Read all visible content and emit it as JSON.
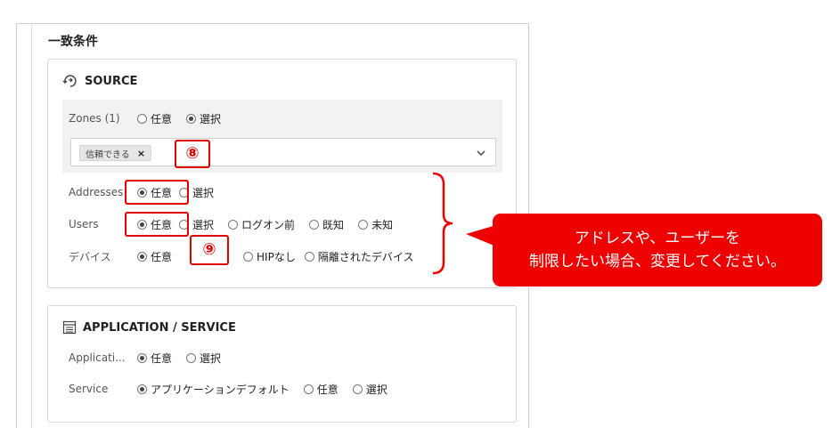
{
  "section": {
    "title": "一致条件"
  },
  "source": {
    "title": "SOURCE",
    "zones": {
      "label": "Zones (1)",
      "options": [
        "任意",
        "選択"
      ],
      "selected": 1
    },
    "zone_tag": {
      "text": "信頼できる",
      "remove": "×"
    },
    "addresses": {
      "label": "Addresses",
      "options": [
        "任意",
        "選択"
      ],
      "selected": 0
    },
    "users": {
      "label": "Users",
      "options": [
        "任意",
        "選択",
        "ログオン前",
        "既知",
        "未知"
      ],
      "selected": 0
    },
    "devices": {
      "label": "デバイス",
      "options": [
        "任意",
        "HIPなし",
        "隔離されたデバイス"
      ],
      "selected": 0
    }
  },
  "app_service": {
    "title": "APPLICATION / SERVICE",
    "applications": {
      "label": "Applicati...",
      "options": [
        "任意",
        "選択"
      ],
      "selected": 0
    },
    "service": {
      "label": "Service",
      "options": [
        "アプリケーションデフォルト",
        "任意",
        "選択"
      ],
      "selected": 0
    }
  },
  "annotations": {
    "marker_8": "⑧",
    "marker_9": "⑨",
    "callout_line1": "アドレスや、ユーザーを",
    "callout_line2": "制限したい場合、変更してください。",
    "accent_color": "#ee0000"
  }
}
